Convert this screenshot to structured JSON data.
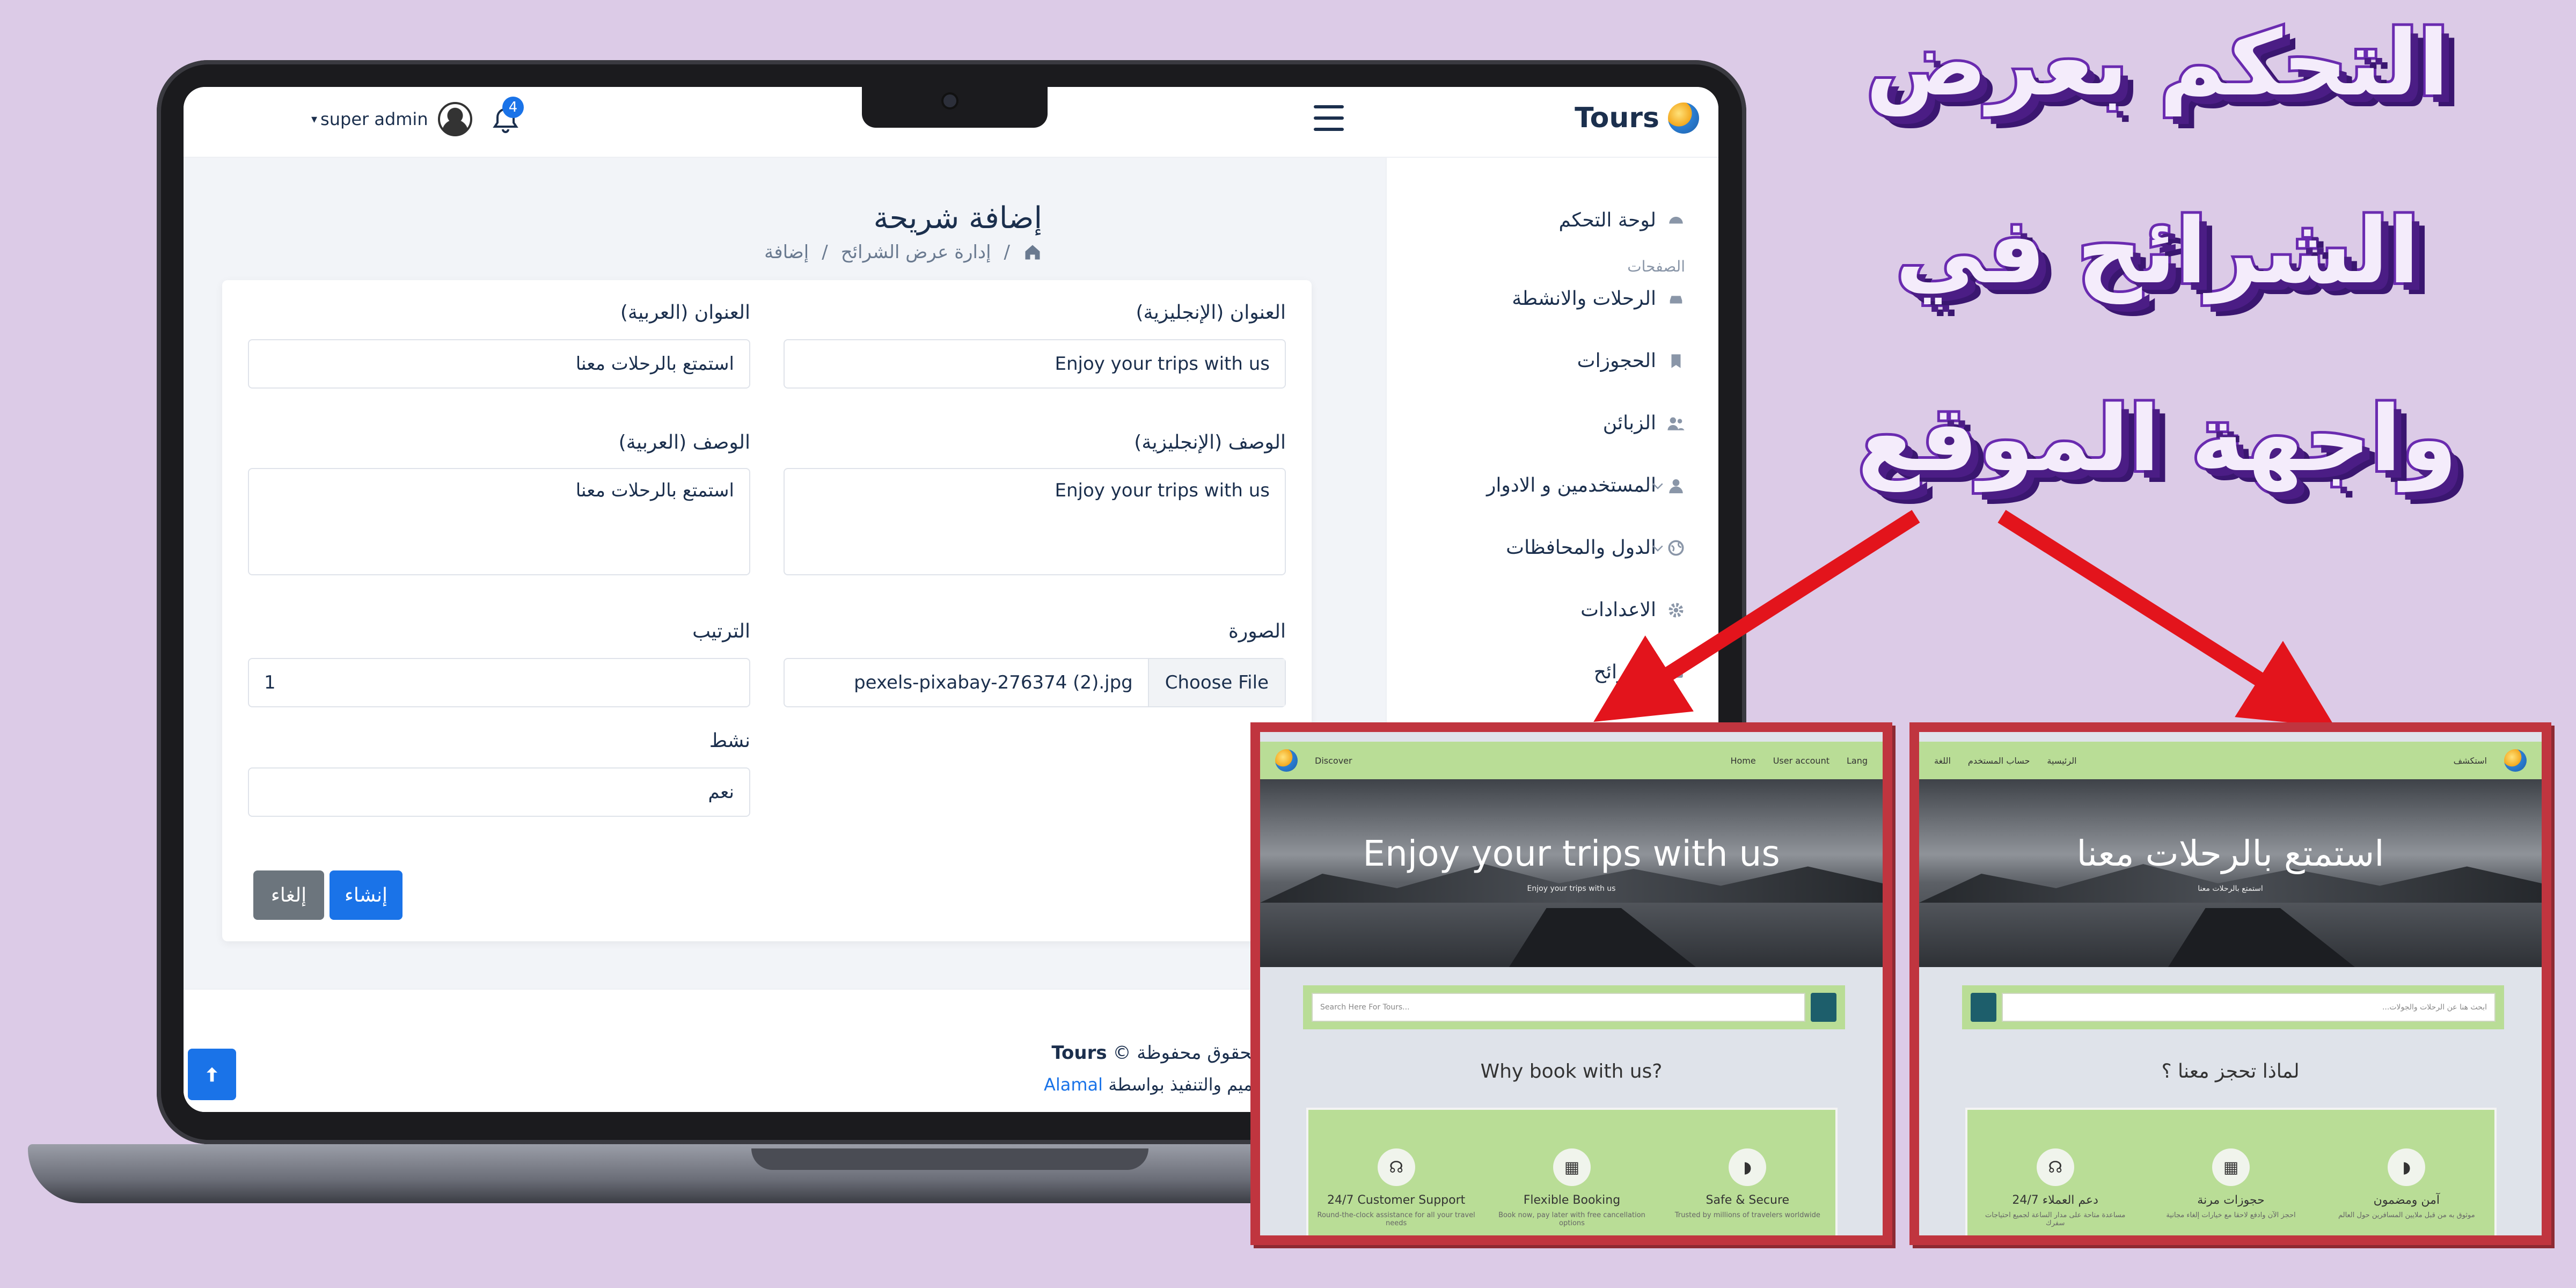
{
  "headline": {
    "line1": "التحكم بعرض",
    "line2": "الشرائح في",
    "line3": "واجهة الموقع"
  },
  "topbar": {
    "brand": "Tours",
    "user": "super admin",
    "notif_count": "4"
  },
  "sidebar": {
    "items": [
      {
        "label": "لوحة التحكم",
        "icon": "gauge-icon"
      },
      {
        "label": "الرحلات والانشطة",
        "icon": "car-icon"
      },
      {
        "label": "الحجوزات",
        "icon": "bookmark-icon"
      },
      {
        "label": "الزبائن",
        "icon": "users-icon"
      },
      {
        "label": "المستخدمين و الادوار",
        "icon": "user-icon"
      },
      {
        "label": "الدول والمحافظات",
        "icon": "globe-icon"
      },
      {
        "label": "الاعدادات",
        "icon": "gear-icon"
      },
      {
        "label": "الشرائح",
        "icon": "sliders-icon"
      }
    ],
    "section_label": "الصفحات"
  },
  "page": {
    "title": "إضافة شريحة",
    "breadcrumb": [
      "إدارة عرض الشرائح",
      "إضافة"
    ],
    "sep": "/"
  },
  "form": {
    "title_en_label": "العنوان (الإنجليزية)",
    "title_en_value": "Enjoy your trips with us",
    "title_ar_label": "العنوان (العربية)",
    "title_ar_value": "استمتع بالرحلات معنا",
    "desc_en_label": "الوصف (الإنجليزية)",
    "desc_en_value": "Enjoy your trips with us",
    "desc_ar_label": "الوصف (العربية)",
    "desc_ar_value": "استمتع بالرحلات معنا",
    "image_label": "الصورة",
    "file_button": "Choose File",
    "file_name": "pexels-pixabay-276374 (2).jpg",
    "order_label": "الترتيب",
    "order_value": "1",
    "active_label": "نشط",
    "active_value": "نعم",
    "create_button": "إنشاء",
    "cancel_button": "إلغاء"
  },
  "footer": {
    "rights": "جميع الحقوق محفوظة ©",
    "brand": "Tours",
    "design": "تم التصميم والتنفيذ بواسطة",
    "designer": "Alamal"
  },
  "preview_en": {
    "nav_left": "Discover",
    "nav_home": "Home",
    "nav_account": "User account",
    "nav_lang": "Lang",
    "hero_title": "Enjoy your trips with us",
    "hero_sub": "Enjoy your trips with us",
    "search_placeholder": "Search Here For Tours...",
    "why": "Why book with us?",
    "features": [
      {
        "title": "24/7 Customer Support",
        "desc": "Round-the-clock assistance for all your travel needs"
      },
      {
        "title": "Flexible Booking",
        "desc": "Book now, pay later with free cancellation options"
      },
      {
        "title": "Safe & Secure",
        "desc": "Trusted by millions of travelers worldwide"
      }
    ]
  },
  "preview_ar": {
    "nav_left": "استكشف",
    "nav_home": "الرئيسية",
    "nav_account": "حساب المستخدم",
    "nav_lang": "اللغة",
    "hero_title": "استمتع بالرحلات معنا",
    "hero_sub": "استمتع بالرحلات معنا",
    "search_placeholder": "ابحث هنا عن الرحلات والجولات...",
    "why": "لماذا تحجز معنا ؟",
    "features": [
      {
        "title": "آمن ومضمون",
        "desc": "موثوق به من قبل ملايين المسافرين حول العالم"
      },
      {
        "title": "حجوزات مرنة",
        "desc": "احجز الآن وادفع لاحقا مع خيارات إلغاء مجانية"
      },
      {
        "title": "دعم العملاء 24/7",
        "desc": "مساعدة متاحة على مدار الساعة لجميع احتياجات سفرك"
      }
    ]
  },
  "colors": {
    "accent": "#1a73e8",
    "headline_fill": "#f4ecfb",
    "headline_stroke": "#6a2bb0",
    "arrow": "#e3141c",
    "preview_frame": "#c0353f",
    "preview_nav": "#b9dd96"
  }
}
